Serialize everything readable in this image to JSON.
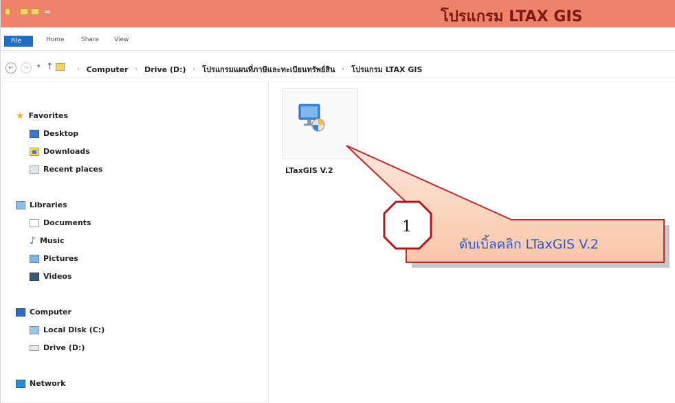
{
  "window": {
    "title": "โปรแกรม LTAX GIS",
    "titlebar_color": "#f0826b",
    "title_color": "#7a1a10"
  },
  "ribbon": {
    "tabs": [
      {
        "label": "File"
      },
      {
        "label": "Home"
      },
      {
        "label": "Share"
      },
      {
        "label": "View"
      }
    ],
    "file_tab_color": "#1f6fc5"
  },
  "address_bar": {
    "back_icon": "back-arrow-icon",
    "forward_icon": "forward-arrow-icon",
    "up_icon": "up-arrow-icon",
    "breadcrumbs": [
      {
        "label": "Computer"
      },
      {
        "label": "Drive (D:)"
      },
      {
        "label": "โปรแกรมแผนที่ภาษีและทะเบียนทรัพย์สิน"
      },
      {
        "label": "โปรแกรม LTAX GIS"
      }
    ]
  },
  "sidebar": {
    "favorites": {
      "label": "Favorites",
      "items": [
        {
          "label": "Desktop"
        },
        {
          "label": "Downloads"
        },
        {
          "label": "Recent places"
        }
      ]
    },
    "libraries": {
      "label": "Libraries",
      "items": [
        {
          "label": "Documents"
        },
        {
          "label": "Music"
        },
        {
          "label": "Pictures"
        },
        {
          "label": "Videos"
        }
      ]
    },
    "computer": {
      "label": "Computer",
      "items": [
        {
          "label": "Local Disk (C:)"
        },
        {
          "label": "Drive (D:)",
          "selected": true
        }
      ]
    },
    "network": {
      "label": "Network"
    }
  },
  "content": {
    "files": [
      {
        "label": "LTaxGIS V.2",
        "icon": "installer-icon"
      }
    ]
  },
  "annotation": {
    "step_number": "1",
    "instruction": "ดับเบิ้ลคลิก LTaxGIS V.2",
    "text_color": "#2f55d4",
    "outline_color": "#c0282a"
  }
}
